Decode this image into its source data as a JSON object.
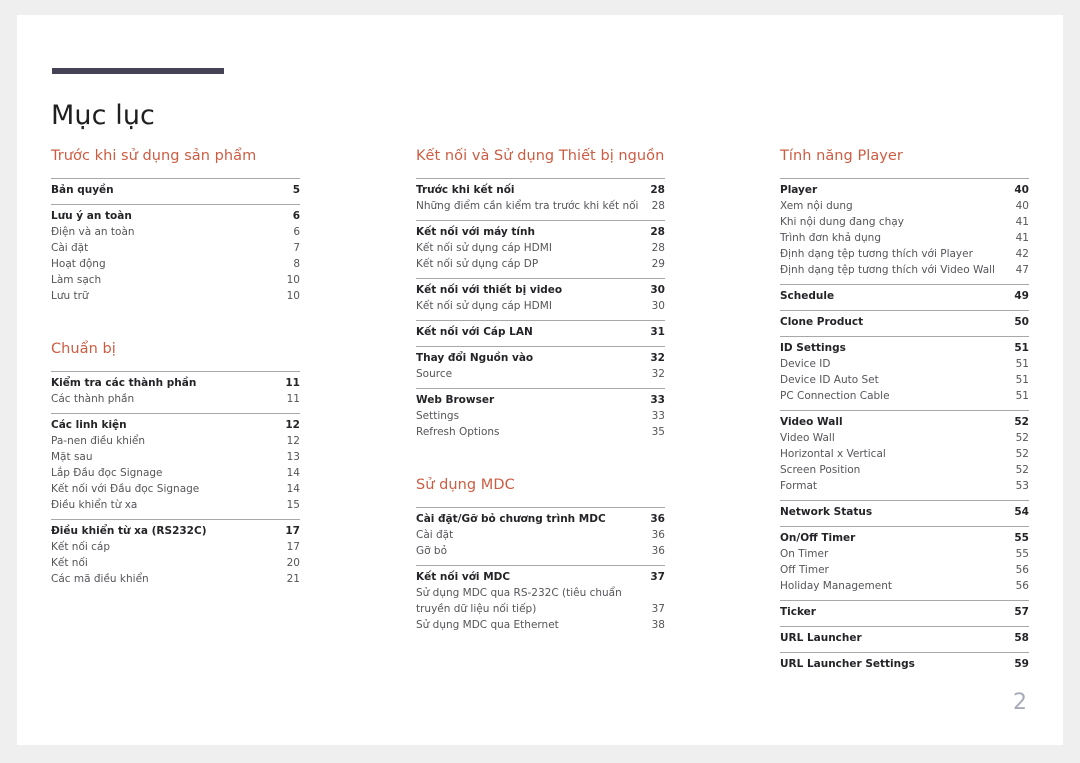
{
  "document": {
    "title": "Mục lục",
    "page_number": "2",
    "accent_color": "#cb5d43",
    "rule_color": "#454256",
    "page_number_color": "#a9aab8"
  },
  "columns": [
    {
      "sections": [
        {
          "heading": "Trước khi sử dụng sản phẩm",
          "groups": [
            {
              "entries": [
                {
                  "label": "Bản quyền",
                  "page": "5",
                  "level": 1
                }
              ]
            },
            {
              "entries": [
                {
                  "label": "Lưu ý an toàn",
                  "page": "6",
                  "level": 1
                },
                {
                  "label": "Điện và an toàn",
                  "page": "6",
                  "level": 2
                },
                {
                  "label": "Cài đặt",
                  "page": "7",
                  "level": 2
                },
                {
                  "label": "Hoạt động",
                  "page": "8",
                  "level": 2
                },
                {
                  "label": "Làm sạch",
                  "page": "10",
                  "level": 2
                },
                {
                  "label": "Lưu trữ",
                  "page": "10",
                  "level": 2
                }
              ]
            }
          ]
        },
        {
          "heading": "Chuẩn bị",
          "groups": [
            {
              "entries": [
                {
                  "label": "Kiểm tra các thành phần",
                  "page": "11",
                  "level": 1
                },
                {
                  "label": "Các thành phần",
                  "page": "11",
                  "level": 2
                }
              ]
            },
            {
              "entries": [
                {
                  "label": "Các linh kiện",
                  "page": "12",
                  "level": 1
                },
                {
                  "label": "Pa-nen điều khiển",
                  "page": "12",
                  "level": 2
                },
                {
                  "label": "Mặt sau",
                  "page": "13",
                  "level": 2
                },
                {
                  "label": "Lắp Đầu đọc Signage",
                  "page": "14",
                  "level": 2
                },
                {
                  "label": "Kết nối với Đầu đọc Signage",
                  "page": "14",
                  "level": 2
                },
                {
                  "label": "Điều khiển từ xa",
                  "page": "15",
                  "level": 2
                }
              ]
            },
            {
              "entries": [
                {
                  "label": "Điều khiển từ xa (RS232C)",
                  "page": "17",
                  "level": 1
                },
                {
                  "label": "Kết nối cáp",
                  "page": "17",
                  "level": 2
                },
                {
                  "label": "Kết nối",
                  "page": "20",
                  "level": 2
                },
                {
                  "label": "Các mã điều khiển",
                  "page": "21",
                  "level": 2
                }
              ]
            }
          ]
        }
      ]
    },
    {
      "sections": [
        {
          "heading": "Kết nối và Sử dụng Thiết bị nguồn",
          "groups": [
            {
              "entries": [
                {
                  "label": "Trước khi kết nối",
                  "page": "28",
                  "level": 1
                },
                {
                  "label": "Những điểm cần kiểm tra trước khi kết nối",
                  "page": "28",
                  "level": 2
                }
              ]
            },
            {
              "entries": [
                {
                  "label": "Kết nối với máy tính",
                  "page": "28",
                  "level": 1
                },
                {
                  "label": "Kết nối sử dụng cáp HDMI",
                  "page": "28",
                  "level": 2
                },
                {
                  "label": "Kết nối sử dụng cáp DP",
                  "page": "29",
                  "level": 2
                }
              ]
            },
            {
              "entries": [
                {
                  "label": "Kết nối với thiết bị video",
                  "page": "30",
                  "level": 1
                },
                {
                  "label": "Kết nối sử dụng cáp HDMI",
                  "page": "30",
                  "level": 2
                }
              ]
            },
            {
              "entries": [
                {
                  "label": "Kết nối với Cáp LAN",
                  "page": "31",
                  "level": 1
                }
              ]
            },
            {
              "entries": [
                {
                  "label": "Thay đổi Nguồn vào",
                  "page": "32",
                  "level": 1
                },
                {
                  "label": "Source",
                  "page": "32",
                  "level": 2
                }
              ]
            },
            {
              "entries": [
                {
                  "label": "Web Browser",
                  "page": "33",
                  "level": 1
                },
                {
                  "label": "Settings",
                  "page": "33",
                  "level": 2
                },
                {
                  "label": "Refresh Options",
                  "page": "35",
                  "level": 2
                }
              ]
            }
          ]
        },
        {
          "heading": "Sử dụng MDC",
          "groups": [
            {
              "entries": [
                {
                  "label": "Cài đặt/Gỡ bỏ chương trình MDC",
                  "page": "36",
                  "level": 1
                },
                {
                  "label": "Cài đặt",
                  "page": "36",
                  "level": 2
                },
                {
                  "label": "Gỡ bỏ",
                  "page": "36",
                  "level": 2
                }
              ]
            },
            {
              "entries": [
                {
                  "label": "Kết nối với MDC",
                  "page": "37",
                  "level": 1
                },
                {
                  "label": "Sử dụng MDC qua RS-232C (tiêu chuẩn truyền dữ liệu nối tiếp)",
                  "page": "37",
                  "level": 2
                },
                {
                  "label": "Sử dụng MDC qua Ethernet",
                  "page": "38",
                  "level": 2
                }
              ]
            }
          ]
        }
      ]
    },
    {
      "sections": [
        {
          "heading": "Tính năng Player",
          "groups": [
            {
              "entries": [
                {
                  "label": "Player",
                  "page": "40",
                  "level": 1
                },
                {
                  "label": "Xem nội dung",
                  "page": "40",
                  "level": 2
                },
                {
                  "label": "Khi nội dung đang chạy",
                  "page": "41",
                  "level": 2
                },
                {
                  "label": "Trình đơn khả dụng",
                  "page": "41",
                  "level": 2
                },
                {
                  "label": "Định dạng tệp tương thích với Player",
                  "page": "42",
                  "level": 2
                },
                {
                  "label": "Định dạng tệp tương thích với Video Wall",
                  "page": "47",
                  "level": 2
                }
              ]
            },
            {
              "entries": [
                {
                  "label": "Schedule",
                  "page": "49",
                  "level": 1
                }
              ]
            },
            {
              "entries": [
                {
                  "label": "Clone Product",
                  "page": "50",
                  "level": 1
                }
              ]
            },
            {
              "entries": [
                {
                  "label": "ID Settings",
                  "page": "51",
                  "level": 1
                },
                {
                  "label": "Device ID",
                  "page": "51",
                  "level": 2
                },
                {
                  "label": "Device ID Auto Set",
                  "page": "51",
                  "level": 2
                },
                {
                  "label": "PC Connection Cable",
                  "page": "51",
                  "level": 2
                }
              ]
            },
            {
              "entries": [
                {
                  "label": "Video Wall",
                  "page": "52",
                  "level": 1
                },
                {
                  "label": "Video Wall",
                  "page": "52",
                  "level": 2
                },
                {
                  "label": "Horizontal x Vertical",
                  "page": "52",
                  "level": 2
                },
                {
                  "label": "Screen Position",
                  "page": "52",
                  "level": 2
                },
                {
                  "label": "Format",
                  "page": "53",
                  "level": 2
                }
              ]
            },
            {
              "entries": [
                {
                  "label": "Network Status",
                  "page": "54",
                  "level": 1
                }
              ]
            },
            {
              "entries": [
                {
                  "label": "On/Off Timer",
                  "page": "55",
                  "level": 1
                },
                {
                  "label": "On Timer",
                  "page": "55",
                  "level": 2
                },
                {
                  "label": "Off Timer",
                  "page": "56",
                  "level": 2
                },
                {
                  "label": "Holiday Management",
                  "page": "56",
                  "level": 2
                }
              ]
            },
            {
              "entries": [
                {
                  "label": "Ticker",
                  "page": "57",
                  "level": 1
                }
              ]
            },
            {
              "entries": [
                {
                  "label": "URL Launcher",
                  "page": "58",
                  "level": 1
                }
              ]
            },
            {
              "entries": [
                {
                  "label": "URL Launcher Settings",
                  "page": "59",
                  "level": 1
                }
              ]
            }
          ]
        }
      ]
    }
  ]
}
